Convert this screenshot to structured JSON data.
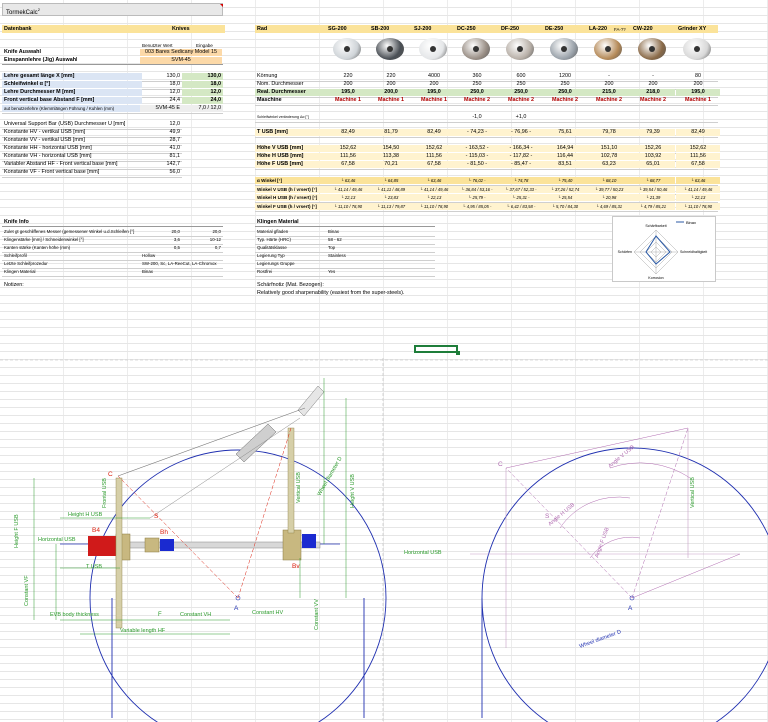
{
  "sheet": {
    "title": "TormekCalc",
    "title_sup": "2",
    "db_label": "Datenbank",
    "knives_label": "Knives",
    "col_user": "Benutzter Wert",
    "col_input": "Eingabe",
    "knife_label": "Knife Auswahl",
    "knife_value": "003 Bares Sedicany Model 15",
    "jig_label": "Einspannlehre (Jig) Auswahl",
    "jig_value": "SVM-45"
  },
  "params": [
    {
      "label": "Lehre gesamt länge X [mm]",
      "user": "130,0",
      "input": "130,0",
      "bold": true
    },
    {
      "label": "Schleifwinkel α [°]",
      "user": "18,0",
      "input": "18,0",
      "bold": true
    },
    {
      "label": "Lehre Durchmesser M [mm]",
      "user": "12,0",
      "input": "12,0",
      "bold": true
    },
    {
      "label": "Front vertical base Abstand F [mm]",
      "user": "24,4",
      "input": "24,0",
      "bold": true
    },
    {
      "label": "aut benutzerlehre (Klemmlängen Führung / Kuhlen (mm)",
      "user": "SVM-45 E",
      "input": "7,0 / 12,0",
      "bold": false
    }
  ],
  "constants": [
    {
      "label": "Universal Support Bar (USB) Durchmesser U [mm]",
      "value": "12,0"
    },
    {
      "label": "Konstante HV - vertikal USB [mm]",
      "value": "49,9"
    },
    {
      "label": "Konstante VV - vertikal USB [mm]",
      "value": "28,7"
    },
    {
      "label": "Konstante HH - horizontal USB [mm]",
      "value": "41,0"
    },
    {
      "label": "Konstante VH - horizontal USB [mm]",
      "value": "81,1"
    },
    {
      "label": "Variabler Abstand HF - Front vertical base [mm]",
      "value": "142,7"
    },
    {
      "label": "Konstante VF - Front vertical base [mm]",
      "value": "56,0"
    }
  ],
  "rad": {
    "label": "Rad",
    "wheels": [
      {
        "name": "SG-200",
        "color": "#cfd4d8"
      },
      {
        "name": "SB-200",
        "color": "#4a4f55"
      },
      {
        "name": "SJ-200",
        "color": "#e4e6e8"
      },
      {
        "name": "DC-250",
        "color": "#9a8f86"
      },
      {
        "name": "DF-250",
        "color": "#b8b0a8"
      },
      {
        "name": "DE-250",
        "color": "#9aa2aa"
      },
      {
        "name": "LA-220",
        "color": "#b58a58"
      },
      {
        "name": "CW-220",
        "color": "#8a6a48"
      },
      {
        "name": "Grinder XY",
        "color": "#d8d8d8"
      }
    ],
    "wheel_extra": "FA-??"
  },
  "wheel_rows": [
    {
      "label": "Körnung",
      "cls": "",
      "bold": false,
      "values": [
        "220",
        "220",
        "4000",
        "360",
        "600",
        "1200",
        "-",
        "-",
        "80"
      ]
    },
    {
      "label": "Nom. Durchmesser",
      "cls": "",
      "bold": false,
      "values": [
        "200",
        "200",
        "200",
        "250",
        "250",
        "250",
        "200",
        "200",
        "200"
      ]
    },
    {
      "label": "Real. Durchmesser",
      "cls": "grn",
      "bold": true,
      "values": [
        "195,0",
        "200,0",
        "195,0",
        "250,0",
        "250,0",
        "250,0",
        "215,0",
        "218,0",
        "195,0"
      ]
    },
    {
      "label": "Maschine",
      "cls": "",
      "bold": true,
      "red": true,
      "values": [
        "Machine 1",
        "Machine 1",
        "Machine 1",
        "Machine 2",
        "Machine 2",
        "Machine 2",
        "Machine 2",
        "Machine 2",
        "Machine 1"
      ]
    }
  ],
  "offset_row": {
    "label": "Schleifwinkel veränderung Δα [°]",
    "values": [
      "",
      "",
      "",
      "-1,0",
      "+1,0",
      "",
      "",
      "",
      ""
    ]
  },
  "tusb": {
    "label": "T USB [mm]",
    "values": [
      "82,49",
      "81,79",
      "82,49",
      "- 74,23 -",
      "- 76,96 -",
      "75,61",
      "79,78",
      "79,39",
      "82,49"
    ]
  },
  "height_rows": [
    {
      "label": "Höhe V USB [mm]",
      "values": [
        "152,62",
        "154,50",
        "152,62",
        "- 163,52 -",
        "- 166,34 -",
        "164,94",
        "151,10",
        "152,26",
        "152,62"
      ]
    },
    {
      "label": "Höhe H USB [mm]",
      "values": [
        "111,56",
        "113,38",
        "111,56",
        "- 115,03 -",
        "- 117,82 -",
        "116,44",
        "102,78",
        "103,92",
        "111,56"
      ]
    },
    {
      "label": "Höhe F USB [mm]",
      "values": [
        "67,58",
        "70,21",
        "67,58",
        "- 81,50 -",
        "- 85,47 -",
        "83,51",
        "63,23",
        "65,01",
        "67,58"
      ]
    }
  ],
  "angle_rows": [
    {
      "label": "α Winkel [°]",
      "values": [
        "└ 63,46",
        "└ 64,85",
        "└ 63,46",
        "└ 76,02 -",
        "└ 74,78",
        "└ 75,40",
        "└ 68,10",
        "└ 68,77",
        "└ 63,46"
      ]
    },
    {
      "label": "Winkel V USB (h / vrsert) [°]",
      "values": [
        "└ 41,14 / 49,46",
        "└ 41,11 / 48,89",
        "└ 41,14 / 49,46",
        "└ 36,84 / 53,16 -",
        "└ 37,67 / 52,33 -",
        "└ 37,26 / 52,74",
        "└ 39,77 / 50,23",
        "└ 39,54 / 50,46",
        "└ 41,14 / 49,46"
      ]
    },
    {
      "label": "Winkel H USB (h / vrsert) [°]",
      "values": [
        "└ 22,13",
        "└ 23,83",
        "└ 22,13",
        "└ 25,79 -",
        "└ 25,31 -",
        "└ 25,54",
        "└ 20,98",
        "└ 21,39",
        "└ 22,13"
      ]
    },
    {
      "label": "Winkel F USB (h / vrsert) [°]",
      "values": [
        "└ 11,10 / 78,90",
        "└ 11,13 / 79,87",
        "└ 11,10 / 78,90",
        "└ 4,95 / 85,05 -",
        "└ 6,42 / 83,58 -",
        "└ 5,70 / 84,30",
        "└ 4,69 / 85,31",
        "└ 4,79 / 85,21",
        "└ 11,10 / 78,90"
      ]
    }
  ],
  "knife_info": {
    "title": "Knife Info",
    "rows": [
      {
        "label": "Zulet gt geschliffenes Messer (gemessener Winkel u.d.Schleifen [°]",
        "a": "20,0",
        "b": "20,0"
      },
      {
        "label": "Klingenstärke [mm] / Schneidenwinkel [°]",
        "a": "3,6",
        "b": "10-12"
      },
      {
        "label": "Kanten stärke (Kanten höhe (mm)",
        "a": "0,5",
        "b": "0,7"
      },
      {
        "label": "Schleifprofil",
        "a": "Hollow",
        "b": ""
      },
      {
        "label": "Letzte Schleifprozedur",
        "a": "SW-200, Sc, LA-ReeCut, LA-Chromox",
        "b": ""
      },
      {
        "label": "Klingen Material",
        "a": "Binax",
        "b": ""
      }
    ],
    "notes_label": "Notizen:"
  },
  "klingen": {
    "title": "Klingen Material",
    "rows": [
      {
        "label": "Material gfladen",
        "value": "Binax"
      },
      {
        "label": "Typ. Härte (HRC)",
        "value": "58 - 62"
      },
      {
        "label": "Qualitätsklasse",
        "value": "Top"
      },
      {
        "label": "Legierung Typ",
        "value": "Stainless"
      },
      {
        "label": "Legierungs Gruppe",
        "value": ""
      },
      {
        "label": "Rostfrei",
        "value": "Yes"
      }
    ],
    "note_label": "Schärfnotiz (Mat. Bezogen):",
    "note_text": "Relatively good sharpenability (easiest from the super-steels)."
  },
  "radar": {
    "legend": "Binax",
    "axes": [
      "Schärfbarkeit",
      "Schneidhaltigkeit",
      "Korrosion",
      "Schärfen"
    ]
  },
  "drawing": {
    "left": {
      "labels": {
        "height_fusb": "Height F USB",
        "frontal_usb": "Frontal USB",
        "height_husb": "Height H USB",
        "horizontal_usb": "Horizontal USB",
        "t_usb": "T USB",
        "constant_vf": "Constant VF",
        "evb_body": "EVB body thickness",
        "constant_vh": "Constant VH",
        "variable_length": "Variable length HF",
        "constant_hv": "Constant HV",
        "constant_vv": "Constant VV",
        "vertical_usb": "Vertical USB",
        "wheel_diameter": "Wheel diameter D",
        "height_vusb": "Height V USB",
        "f": "F",
        "b4": "B4",
        "bh": "Bh",
        "bv": "Bv",
        "c": "C",
        "s": "S",
        "a": "A"
      }
    },
    "right": {
      "labels": {
        "horizontal_usb": "Horizontal USB",
        "angle_husb": "Angle H USB",
        "angle_vusb": "Angle V USB",
        "angle_fusb": "Angle F USB",
        "vertical_usb": "Vertical USB",
        "wheel_diameter": "Wheel diameter D",
        "c": "C",
        "s": "S",
        "a": "A"
      }
    }
  }
}
